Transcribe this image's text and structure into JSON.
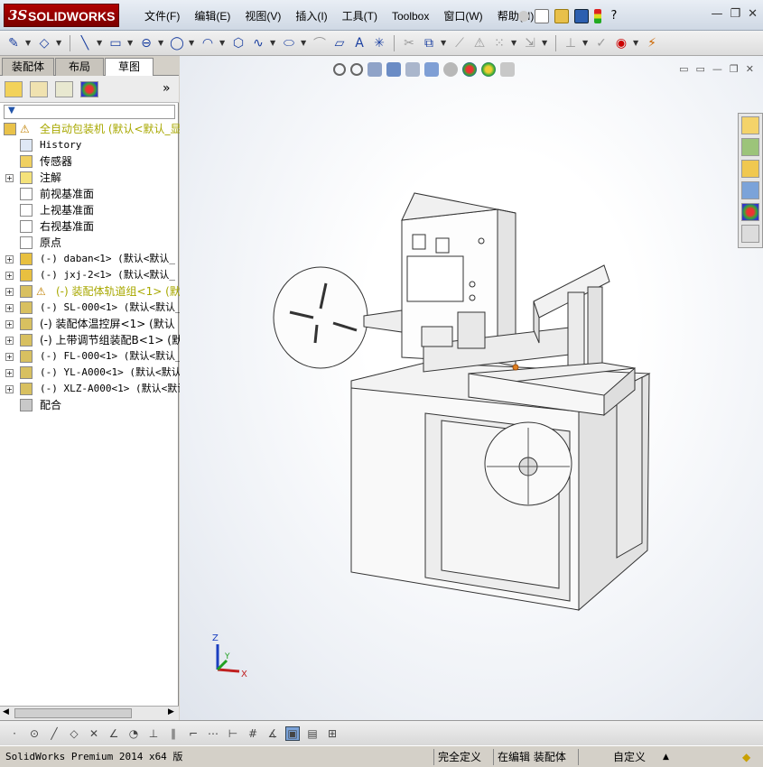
{
  "app": {
    "logo_ds": "3S",
    "logo_name": "SOLIDWORKS"
  },
  "menu": {
    "items": [
      "文件(F)",
      "编辑(E)",
      "视图(V)",
      "插入(I)",
      "工具(T)",
      "Toolbox",
      "窗口(W)",
      "帮助(H)"
    ]
  },
  "left_panel": {
    "tabs": [
      "装配体",
      "布局",
      "草图"
    ],
    "active_tab": "草图",
    "expand_glyph": "»",
    "tree": [
      {
        "label": "全自动包装机  (默认<默认_显",
        "icon": "assembly-warning-icon",
        "level": 0,
        "expand": false,
        "warning": true
      },
      {
        "label": "History",
        "icon": "history-icon",
        "level": 1,
        "expand": false,
        "mono": true
      },
      {
        "label": "传感器",
        "icon": "sensor-icon",
        "level": 1,
        "expand": false
      },
      {
        "label": "注解",
        "icon": "annotation-icon",
        "level": 1,
        "expand": true
      },
      {
        "label": "前视基准面",
        "icon": "plane-icon",
        "level": 1,
        "expand": false
      },
      {
        "label": "上视基准面",
        "icon": "plane-icon",
        "level": 1,
        "expand": false
      },
      {
        "label": "右视基准面",
        "icon": "plane-icon",
        "level": 1,
        "expand": false
      },
      {
        "label": "原点",
        "icon": "origin-icon",
        "level": 1,
        "expand": false
      },
      {
        "label": "(-) daban<1> (默认<默认_",
        "icon": "part-icon",
        "level": 1,
        "expand": true,
        "mono": true
      },
      {
        "label": "(-) jxj-2<1> (默认<默认_",
        "icon": "part-icon",
        "level": 1,
        "expand": true,
        "mono": true
      },
      {
        "label": "(-) 装配体轨道组<1> (默",
        "icon": "subassembly-warning-icon",
        "level": 1,
        "expand": true,
        "warning": true
      },
      {
        "label": "(-) SL-000<1> (默认<默认_显",
        "icon": "subassembly-icon",
        "level": 1,
        "expand": true,
        "mono": true
      },
      {
        "label": "(-) 装配体温控屏<1> (默认",
        "icon": "subassembly-icon",
        "level": 1,
        "expand": true
      },
      {
        "label": "(-) 上带调节组装配B<1> (默",
        "icon": "subassembly-icon",
        "level": 1,
        "expand": true
      },
      {
        "label": "(-) FL-000<1> (默认<默认_显",
        "icon": "subassembly-icon",
        "level": 1,
        "expand": true,
        "mono": true
      },
      {
        "label": "(-) YL-A000<1> (默认<默认_",
        "icon": "subassembly-icon",
        "level": 1,
        "expand": true,
        "mono": true
      },
      {
        "label": "(-) XLZ-A000<1> (默认<默认",
        "icon": "subassembly-icon",
        "level": 1,
        "expand": true,
        "mono": true
      },
      {
        "label": "配合",
        "icon": "mates-icon",
        "level": 1,
        "expand": false
      }
    ]
  },
  "viewport": {
    "triad_labels": {
      "x": "X",
      "y": "Y",
      "z": "Z"
    }
  },
  "status": {
    "product": "SolidWorks Premium 2014 x64 版",
    "definition": "完全定义",
    "mode": "在编辑 装配体",
    "units": "自定义",
    "units_arrow": "▲"
  },
  "colors": {
    "brand_red": "#a00000",
    "warning": "#a8a800",
    "toolbar_blue": "#1a3fa0"
  }
}
